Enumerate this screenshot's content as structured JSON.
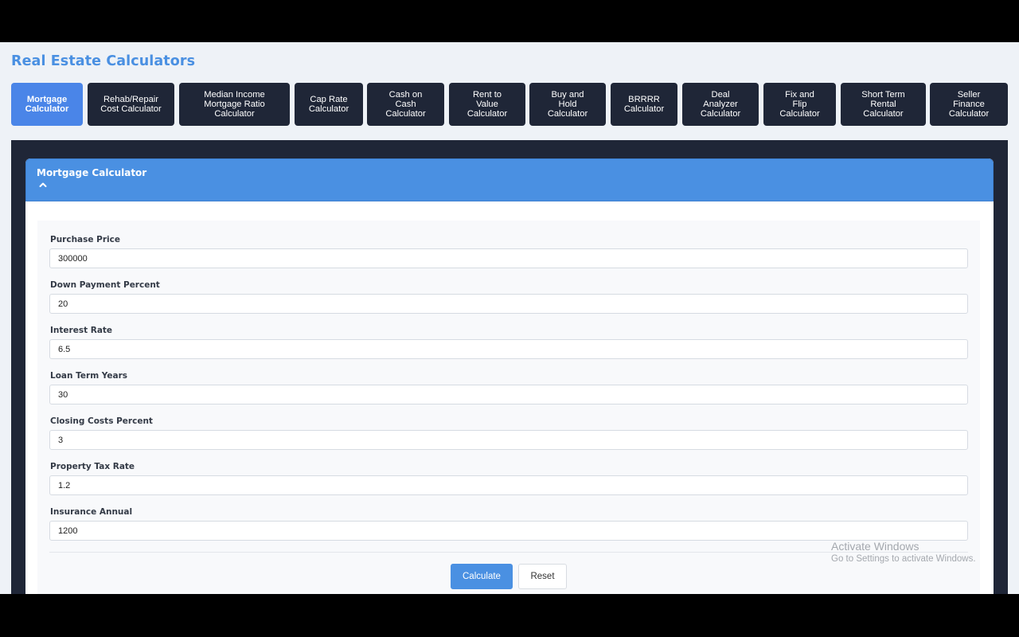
{
  "app": {
    "title": "Real Estate Calculators"
  },
  "tabs": [
    {
      "label": "Mortgage\nCalculator",
      "active": true
    },
    {
      "label": "Rehab/Repair\nCost Calculator",
      "active": false
    },
    {
      "label": "Median Income\nMortgage Ratio\nCalculator",
      "active": false
    },
    {
      "label": "Cap Rate\nCalculator",
      "active": false
    },
    {
      "label": "Cash on\nCash\nCalculator",
      "active": false
    },
    {
      "label": "Rent to\nValue\nCalculator",
      "active": false
    },
    {
      "label": "Buy and\nHold\nCalculator",
      "active": false
    },
    {
      "label": "BRRRR\nCalculator",
      "active": false
    },
    {
      "label": "Deal\nAnalyzer\nCalculator",
      "active": false
    },
    {
      "label": "Fix and\nFlip\nCalculator",
      "active": false
    },
    {
      "label": "Short Term\nRental\nCalculator",
      "active": false
    },
    {
      "label": "Seller\nFinance\nCalculator",
      "active": false
    }
  ],
  "card": {
    "title": "Mortgage Calculator",
    "collapse_icon": "chevron-up-icon"
  },
  "form": {
    "fields": [
      {
        "label": "Purchase Price",
        "value": "300000"
      },
      {
        "label": "Down Payment Percent",
        "value": "20"
      },
      {
        "label": "Interest Rate",
        "value": "6.5"
      },
      {
        "label": "Loan Term Years",
        "value": "30"
      },
      {
        "label": "Closing Costs Percent",
        "value": "3"
      },
      {
        "label": "Property Tax Rate",
        "value": "1.2"
      },
      {
        "label": "Insurance Annual",
        "value": "1200"
      }
    ],
    "calculate_label": "Calculate",
    "reset_label": "Reset"
  },
  "watermark": {
    "title": "Activate Windows",
    "subtitle": "Go to Settings to activate Windows."
  },
  "colors": {
    "accent": "#4a90e2",
    "active_tab": "#4a85e8",
    "dark_tab": "#1f2637",
    "title": "#4a90e2"
  }
}
